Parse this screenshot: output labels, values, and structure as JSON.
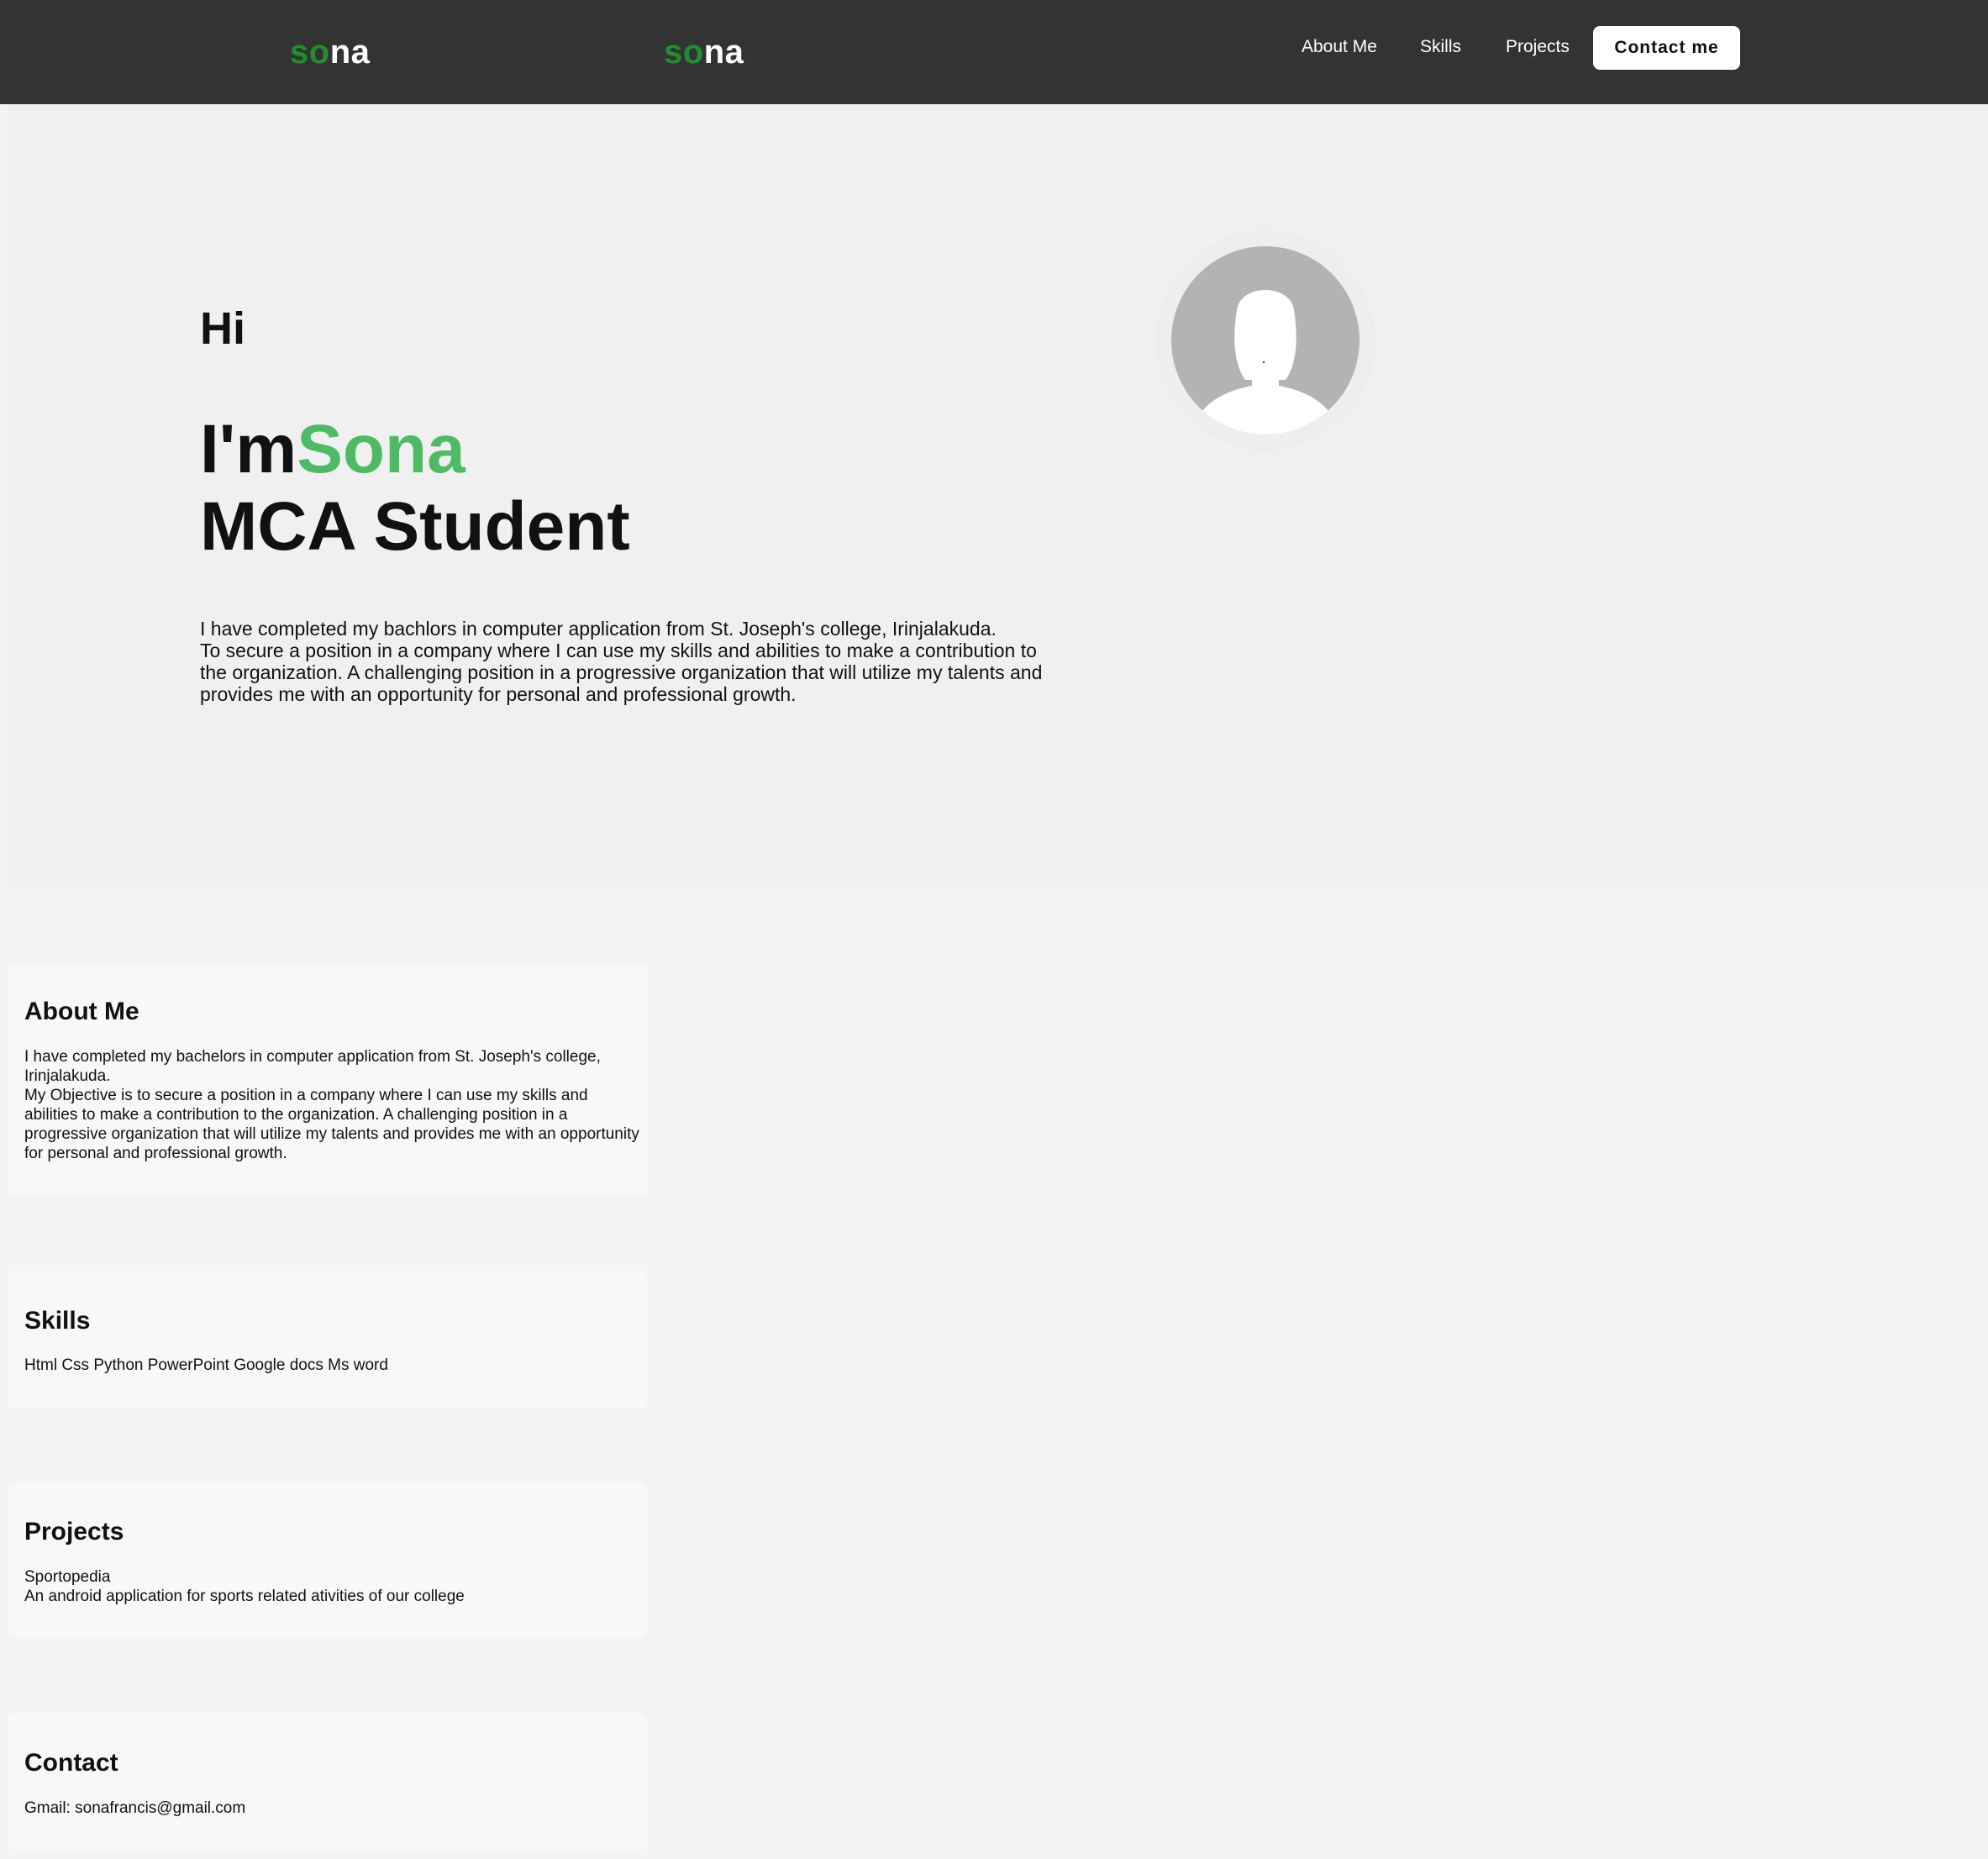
{
  "nav": {
    "logo_primary": {
      "accent": "so",
      "rest": "na"
    },
    "logo_secondary": {
      "accent": "so",
      "rest": "na"
    },
    "links": [
      "About Me",
      "Skills",
      "Projects"
    ],
    "contact_button": "Contact me"
  },
  "hero": {
    "greeting": "Hi",
    "intro_prefix": "I'm",
    "name": "Sona",
    "role": "MCA Student",
    "paragraph_line1": "I have completed my bachlors in computer application from St. Joseph's college, Irinjalakuda.",
    "paragraph_line2": "To secure a position in a company where I can use my skills and abilities to make a contribution to the organization. A challenging position in a progressive organization that will utilize my talents and provides me with an opportunity for personal and professional growth.",
    "avatar_icon": "female-user-placeholder-icon"
  },
  "sections": {
    "about": {
      "title": "About Me",
      "line1": "I have completed my bachelors in computer application from St. Joseph's college, Irinjalakuda.",
      "line2": "My Objective is to secure a position in a company where I can use my skills and abilities to make a contribution to the organization. A challenging position in a progressive organization that will utilize my talents and provides me with an opportunity for personal and professional growth."
    },
    "skills": {
      "title": "Skills",
      "text": "Html Css Python PowerPoint Google docs Ms word"
    },
    "projects": {
      "title": "Projects",
      "name": "Sportopedia",
      "description": "An android application for sports related ativities of our college"
    },
    "contact": {
      "title": "Contact",
      "text": "Gmail: sonafrancis@gmail.com"
    }
  },
  "colors": {
    "nav_bg": "#333333",
    "logo_accent": "#1f8f2e",
    "name_accent": "#4cbb64",
    "page_bg": "#f4f4f4",
    "hero_bg": "#f0f0f0",
    "card_bg": "#f8f8f8"
  }
}
